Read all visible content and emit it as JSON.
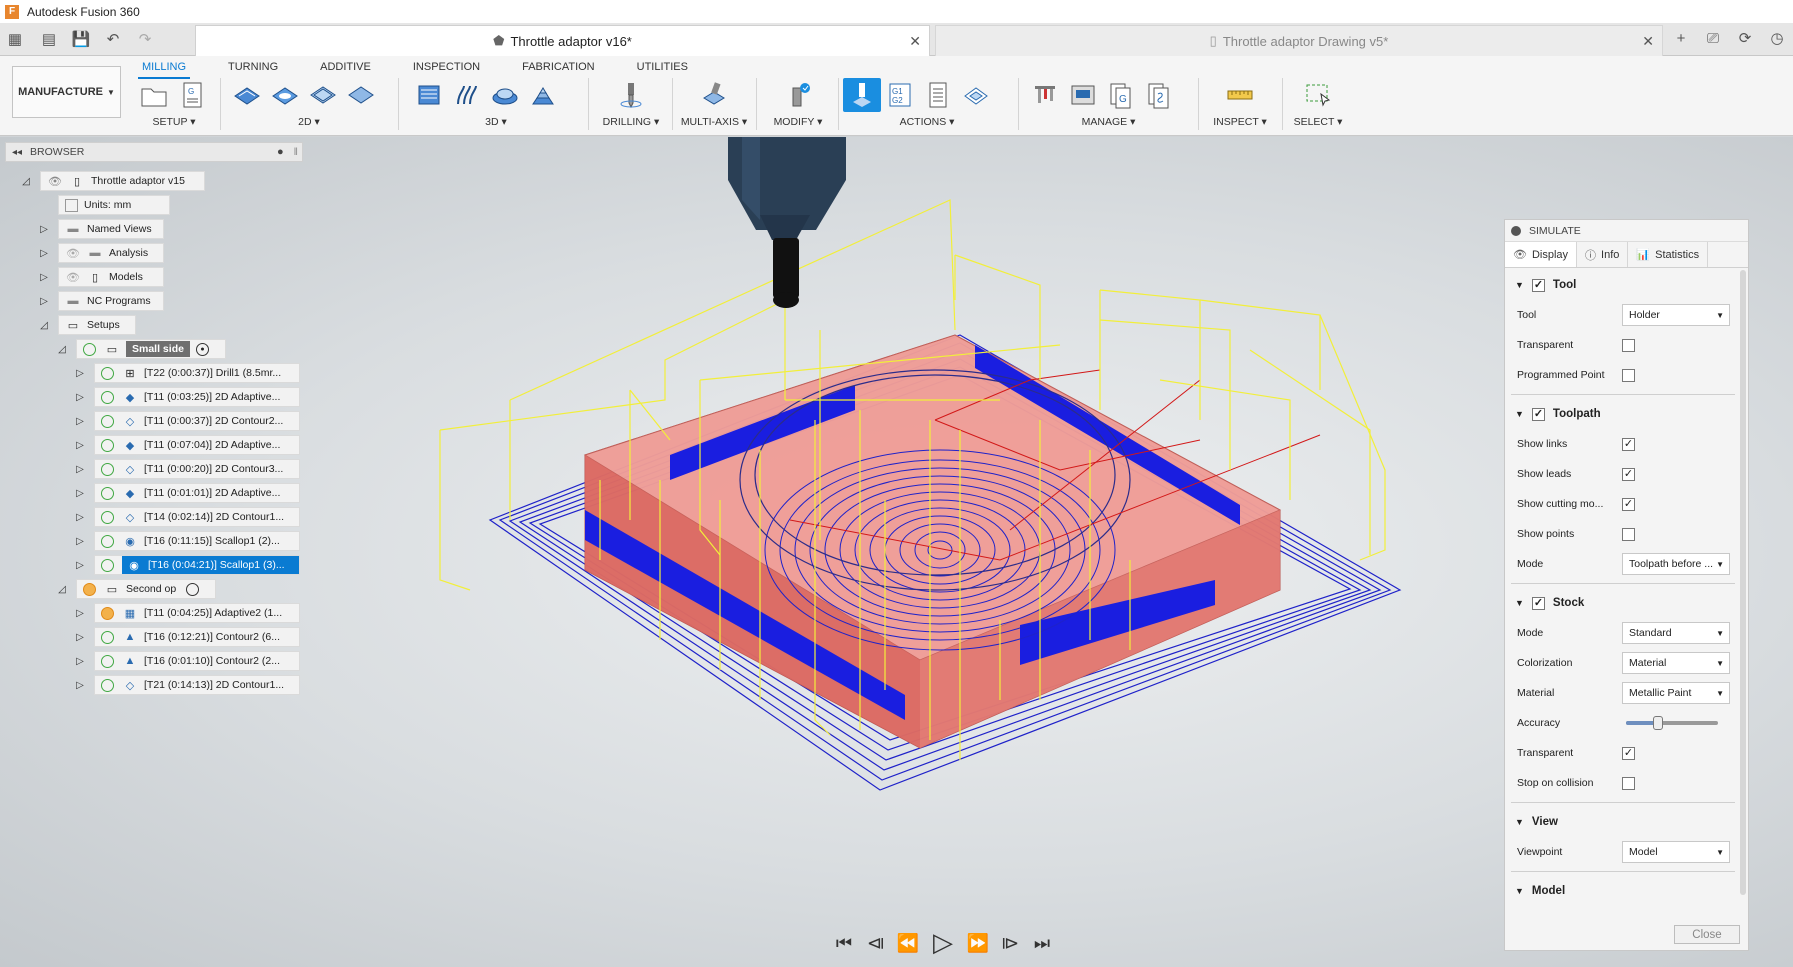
{
  "app": {
    "title": "Autodesk Fusion 360",
    "logo_letter": "F"
  },
  "tabs": [
    {
      "label": "Throttle adaptor v16*",
      "active": true
    },
    {
      "label": "Throttle adaptor Drawing v5*",
      "active": false
    }
  ],
  "ribbon": {
    "workspace": "MANUFACTURE",
    "tabs": [
      "MILLING",
      "TURNING",
      "ADDITIVE",
      "INSPECTION",
      "FABRICATION",
      "UTILITIES"
    ],
    "groups": [
      "SETUP",
      "2D",
      "3D",
      "DRILLING",
      "MULTI-AXIS",
      "MODIFY",
      "ACTIONS",
      "MANAGE",
      "INSPECT",
      "SELECT"
    ]
  },
  "browser": {
    "title": "BROWSER",
    "rows": [
      {
        "label": "Throttle adaptor v15"
      },
      {
        "label": "Units: mm"
      },
      {
        "label": "Named Views"
      },
      {
        "label": "Analysis"
      },
      {
        "label": "Models"
      },
      {
        "label": "NC Programs"
      },
      {
        "label": "Setups"
      },
      {
        "label": "Small side"
      },
      {
        "label": "[T22 (0:00:37)] Drill1 (8.5mr..."
      },
      {
        "label": "[T11 (0:03:25)] 2D Adaptive..."
      },
      {
        "label": "[T11 (0:00:37)] 2D Contour2..."
      },
      {
        "label": "[T11 (0:07:04)] 2D Adaptive..."
      },
      {
        "label": "[T11 (0:00:20)] 2D Contour3..."
      },
      {
        "label": "[T11 (0:01:01)] 2D Adaptive..."
      },
      {
        "label": "[T14 (0:02:14)] 2D Contour1..."
      },
      {
        "label": "[T16 (0:11:15)] Scallop1 (2)..."
      },
      {
        "label": "[T16 (0:04:21)] Scallop1 (3)..."
      },
      {
        "label": "Second op"
      },
      {
        "label": "[T11 (0:04:25)] Adaptive2 (1..."
      },
      {
        "label": "[T16 (0:12:21)] Contour2 (6..."
      },
      {
        "label": "[T16 (0:01:10)] Contour2 (2..."
      },
      {
        "label": "[T21 (0:14:13)] 2D Contour1..."
      }
    ]
  },
  "simulate": {
    "title": "SIMULATE",
    "tabs": [
      "Display",
      "Info",
      "Statistics"
    ],
    "tool": {
      "header": "Tool",
      "tool_label": "Tool",
      "tool_value": "Holder",
      "transparent": "Transparent",
      "programmed_point": "Programmed Point"
    },
    "toolpath": {
      "header": "Toolpath",
      "show_links": "Show links",
      "show_leads": "Show leads",
      "show_cutting": "Show cutting mo...",
      "show_points": "Show points",
      "mode_label": "Mode",
      "mode_value": "Toolpath before ..."
    },
    "stock": {
      "header": "Stock",
      "mode_label": "Mode",
      "mode_value": "Standard",
      "colorization_label": "Colorization",
      "colorization_value": "Material",
      "material_label": "Material",
      "material_value": "Metallic Paint",
      "accuracy_label": "Accuracy",
      "accuracy_level": 0.35,
      "transparent": "Transparent",
      "stop_on_collision": "Stop on collision"
    },
    "view": {
      "header": "View",
      "viewpoint_label": "Viewpoint",
      "viewpoint_value": "Model"
    },
    "model": {
      "header": "Model"
    },
    "close": "Close"
  },
  "colors": {
    "accent": "#0a7bd2",
    "stock": "#e8827c",
    "toolpath_links": "#f2ef3a",
    "toolpath_cut": "#1f22c9"
  }
}
